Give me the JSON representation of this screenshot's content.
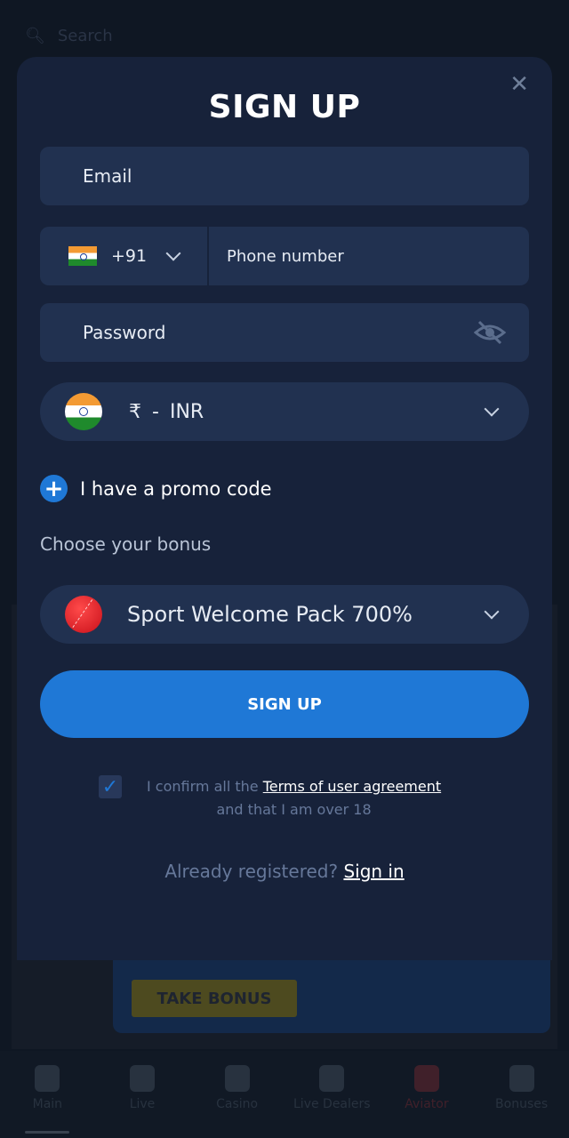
{
  "background": {
    "search_placeholder": "Search",
    "take_bonus": "TAKE BONUS",
    "nav": [
      "Main",
      "Live",
      "Casino",
      "Live Dealers",
      "Aviator",
      "Bonuses"
    ]
  },
  "modal": {
    "title": "SIGN UP",
    "email_placeholder": "Email",
    "country_code": "+91",
    "phone_placeholder": "Phone number",
    "password_placeholder": "Password",
    "currency_symbol": "₹",
    "currency_sep": "-",
    "currency": "INR",
    "promo_label": "I have a promo code",
    "choose_bonus": "Choose your bonus",
    "bonus_selected": "Sport Welcome Pack 700%",
    "submit": "SIGN UP",
    "confirm_pre": "I confirm all the",
    "terms_link": "Terms of user agreement",
    "confirm_post": "and that I am over 18",
    "terms_checked": true,
    "already": "Already registered?",
    "sign_in": "Sign in"
  },
  "colors": {
    "accent": "#1f78d6",
    "modal_bg": "#17223a",
    "field_bg": "#213150"
  }
}
